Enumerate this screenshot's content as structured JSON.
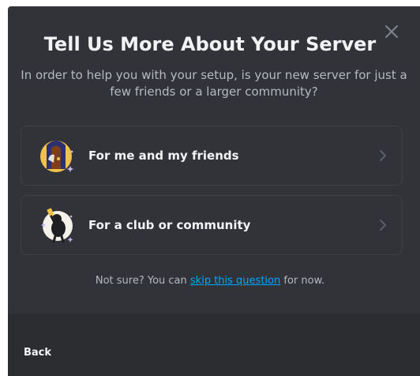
{
  "modal": {
    "title": "Tell Us More About Your Server",
    "subtitle": "In order to help you with your setup, is your new server for just a few friends or a larger community?",
    "close_icon": "close-icon"
  },
  "options": [
    {
      "label": "For me and my friends",
      "icon": "friends-door-illustration",
      "chevron": "chevron-right-icon"
    },
    {
      "label": "For a club or community",
      "icon": "club-community-illustration",
      "chevron": "chevron-right-icon"
    }
  ],
  "skip": {
    "prefix": "Not sure? You can ",
    "link_text": "skip this question",
    "suffix": " for now."
  },
  "footer": {
    "back_label": "Back"
  },
  "colors": {
    "modal_bg": "#313338",
    "footer_bg": "#2b2d31",
    "option_border": "#3f4147",
    "title_text": "#f2f3f5",
    "body_text": "#b5bac1",
    "link": "#00a8fc"
  }
}
